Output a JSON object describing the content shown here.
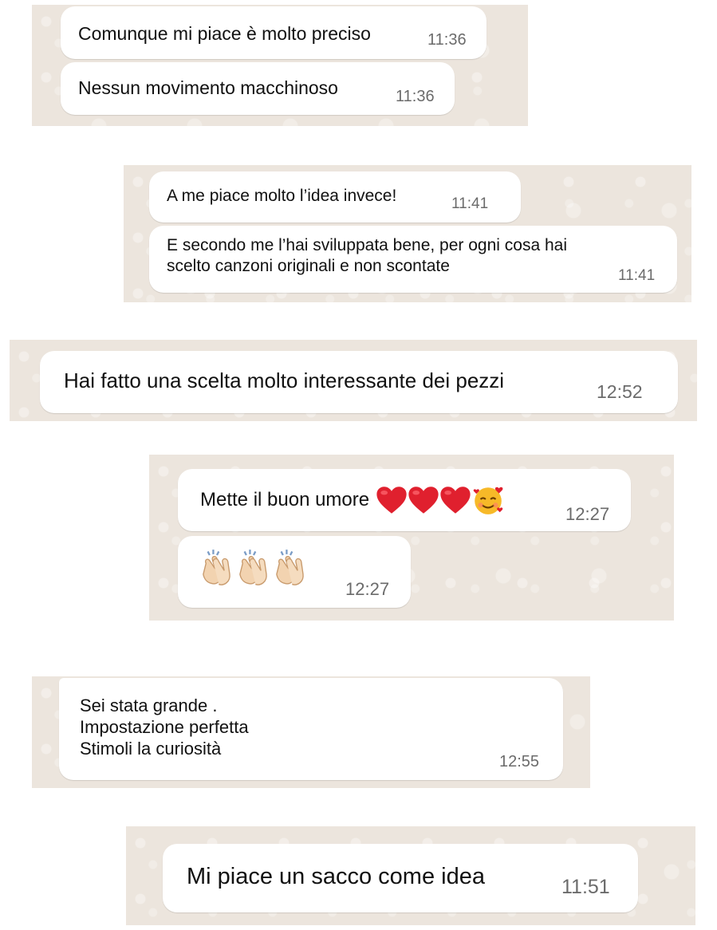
{
  "groups": [
    {
      "messages": [
        {
          "text": "Comunque mi piace è molto preciso",
          "time": "11:36"
        },
        {
          "text": "Nessun movimento macchinoso",
          "time": "11:36"
        }
      ]
    },
    {
      "messages": [
        {
          "text": "A me piace molto l’idea invece!",
          "time": "11:41"
        },
        {
          "text": "E secondo me l’hai sviluppata bene, per ogni cosa hai\nscelto canzoni originali e non scontate",
          "time": "11:41"
        }
      ]
    },
    {
      "messages": [
        {
          "text": "Hai fatto una scelta molto interessante  dei pezzi",
          "time": "12:52"
        }
      ]
    },
    {
      "messages": [
        {
          "text": "Mette il buon umore",
          "time": "12:27",
          "emojis": [
            "heart-icon",
            "heart-icon",
            "heart-icon",
            "smiling-face-with-hearts-icon"
          ]
        },
        {
          "text": "",
          "time": "12:27",
          "emojis": [
            "clapping-hands-icon",
            "clapping-hands-icon",
            "clapping-hands-icon"
          ]
        }
      ]
    },
    {
      "messages": [
        {
          "text": "Sei stata grande .\nImpostazione perfetta\nStimoli  la curiosità",
          "time": "12:55"
        }
      ]
    },
    {
      "messages": [
        {
          "text": "Mi piace un sacco come idea",
          "time": "11:51"
        }
      ]
    }
  ],
  "colors": {
    "chat_background": "#ece5dd",
    "bubble": "#ffffff",
    "timestamp": "#6b6b6b",
    "heart": "#e0202e"
  }
}
